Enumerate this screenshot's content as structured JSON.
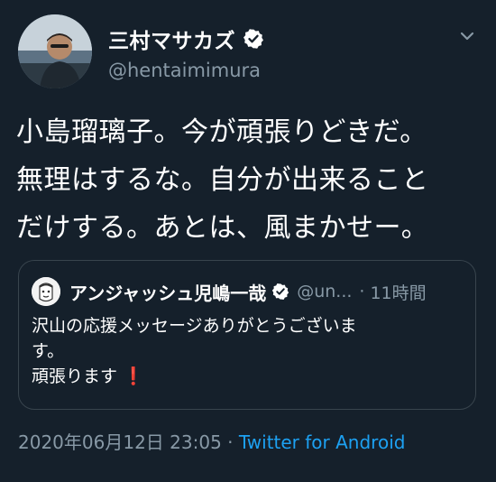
{
  "tweet": {
    "author": {
      "name": "三村マサカズ",
      "handle": "@hentaimimura"
    },
    "text_lines": [
      "小島瑠璃子。今が頑張りどきだ。",
      "無理はするな。自分が出来ること",
      "だけする。あとは、風まかせー。"
    ],
    "quote": {
      "author_name": "アンジャッシュ児嶋一哉",
      "handle": "@un...",
      "separator": "·",
      "time": "11時間",
      "text_lines": [
        "沢山の応援メッセージありがとうございま",
        "す。",
        "頑張ります"
      ],
      "emoji": "❗"
    },
    "timestamp": "2020年06月12日 23:05",
    "separator": "·",
    "source": "Twitter for Android"
  },
  "colors": {
    "background": "#15202b",
    "text": "#ffffff",
    "secondary_text": "#8899a6",
    "link": "#1da1f2",
    "border": "#38444d"
  },
  "icons": [
    "verified-badge-icon",
    "chevron-down-icon",
    "profile-avatar",
    "quoted-profile-avatar"
  ]
}
